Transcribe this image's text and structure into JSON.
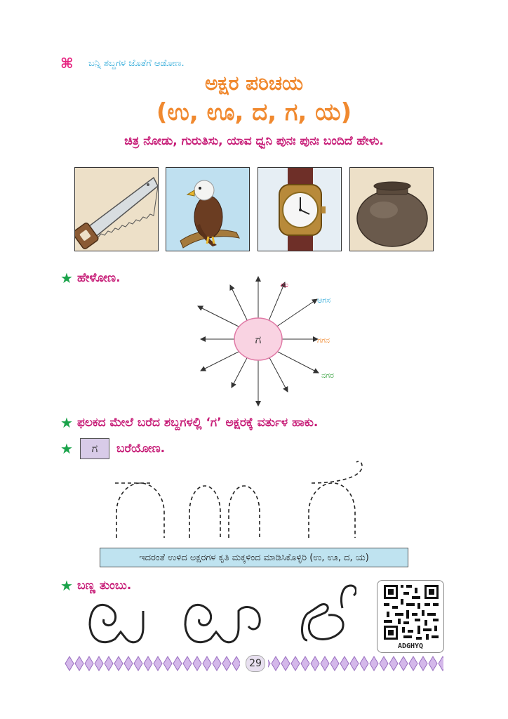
{
  "header": {
    "icon": "command-icon",
    "text": "ಬನ್ನಿ ಶಬ್ದಗಳ ಜೊತೆಗೆ ಆಡೋಣ."
  },
  "title": {
    "line1": "ಅಕ್ಷರ ಪರಿಚಯ",
    "line2": "(ಉ, ಊ, ದ, ಗ, ಯ)"
  },
  "instruction": "ಚಿತ್ರ ನೋಡು, ಗುರುತಿಸು, ಯಾವ ಧ್ವನಿ ಪುನಃ ಪುನಃ ಬಂದಿದೆ ಹೇಳು.",
  "pictures": [
    {
      "name": "saw",
      "icon": "saw-icon"
    },
    {
      "name": "eagle",
      "icon": "eagle-icon"
    },
    {
      "name": "watch",
      "icon": "watch-icon"
    },
    {
      "name": "pot",
      "icon": "pot-icon"
    }
  ],
  "section_speak": {
    "label": "ಹೇಳೋಣ.",
    "center_letter": "ಗ",
    "words": [
      "ಗಂ",
      "ಆಗಸ",
      "ಗಗನ",
      "ನಗರ"
    ],
    "colors": {
      "bubble": "#f9d3e2",
      "word1": "#d6245c",
      "word2": "#2aa8d8",
      "word3": "#f0892f",
      "word4": "#38a23f"
    }
  },
  "section_circle": {
    "label": "ಫಲಕದ ಮೇಲೆ ಬರೆದ ಶಬ್ದಗಳಲ್ಲಿ ‘ಗ’ ಅಕ್ಷರಕ್ಕೆ ವರ್ತುಳ ಹಾಕು."
  },
  "section_write": {
    "letter": "ಗ",
    "label": "ಬರೆಯೋಣ."
  },
  "hint": "ಇದರಂತೆ ಉಳಿದ ಅಕ್ಷರಗಳ ಕೃತಿ ಮಕ್ಕಳಿಂದ ಮಾಡಿಸಿಕೊಳ್ಳಿರಿ (ಉ, ಊ, ದ, ಯ)",
  "section_color": {
    "label": "ಬಣ್ಣ ತುಂಬು."
  },
  "qr": {
    "caption": "ADGHYQ"
  },
  "page_number": "29",
  "colors": {
    "accent": "#c71e78",
    "title": "#f0892f",
    "star": "#1aa34a",
    "border_diamond": "#c8a8e0"
  }
}
